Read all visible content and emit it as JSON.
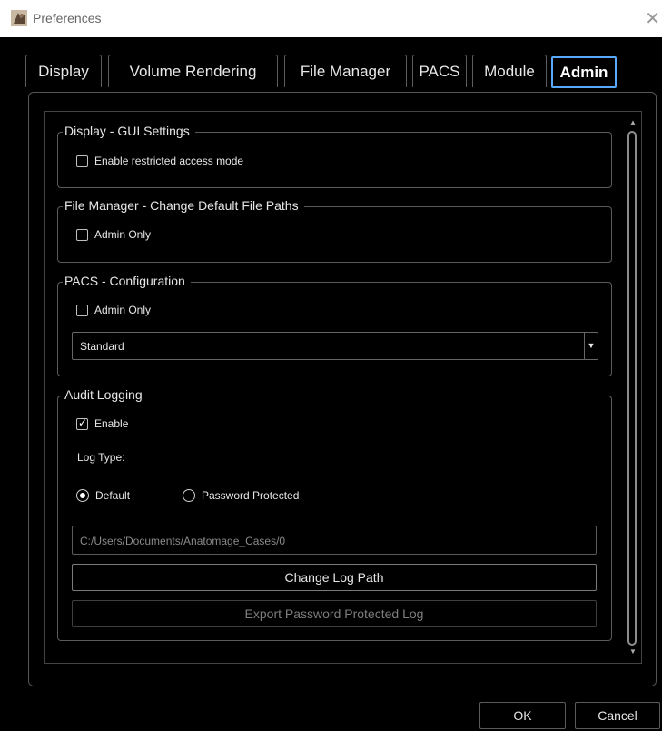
{
  "window": {
    "title": "Preferences",
    "close_glyph": "✕"
  },
  "tabs": [
    {
      "label": "Display",
      "active": false
    },
    {
      "label": "Volume Rendering",
      "active": false
    },
    {
      "label": "File Manager",
      "active": false
    },
    {
      "label": "PACS",
      "active": false
    },
    {
      "label": "Module",
      "active": false
    },
    {
      "label": "Admin",
      "active": true
    }
  ],
  "groups": {
    "display_gui": {
      "title": "Display - GUI Settings",
      "restricted_mode": {
        "label": "Enable restricted access mode",
        "checked": false
      }
    },
    "file_manager": {
      "title": "File Manager - Change Default File Paths",
      "admin_only": {
        "label": "Admin Only",
        "checked": false
      }
    },
    "pacs": {
      "title": "PACS - Configuration",
      "admin_only": {
        "label": "Admin Only",
        "checked": false
      },
      "mode_select": {
        "value": "Standard"
      }
    },
    "audit": {
      "title": "Audit Logging",
      "enable": {
        "label": "Enable",
        "checked": true
      },
      "log_type_label": "Log Type:",
      "log_type_options": [
        {
          "label": "Default",
          "selected": true
        },
        {
          "label": "Password Protected",
          "selected": false
        }
      ],
      "log_path_placeholder": "C:/Users/Documents/Anatomage_Cases/0",
      "change_log_path_label": "Change Log Path",
      "export_log_label": "Export Password Protected Log"
    }
  },
  "footer": {
    "ok_label": "OK",
    "cancel_label": "Cancel"
  },
  "colors": {
    "accent": "#5aa9ff",
    "background": "#000000"
  }
}
